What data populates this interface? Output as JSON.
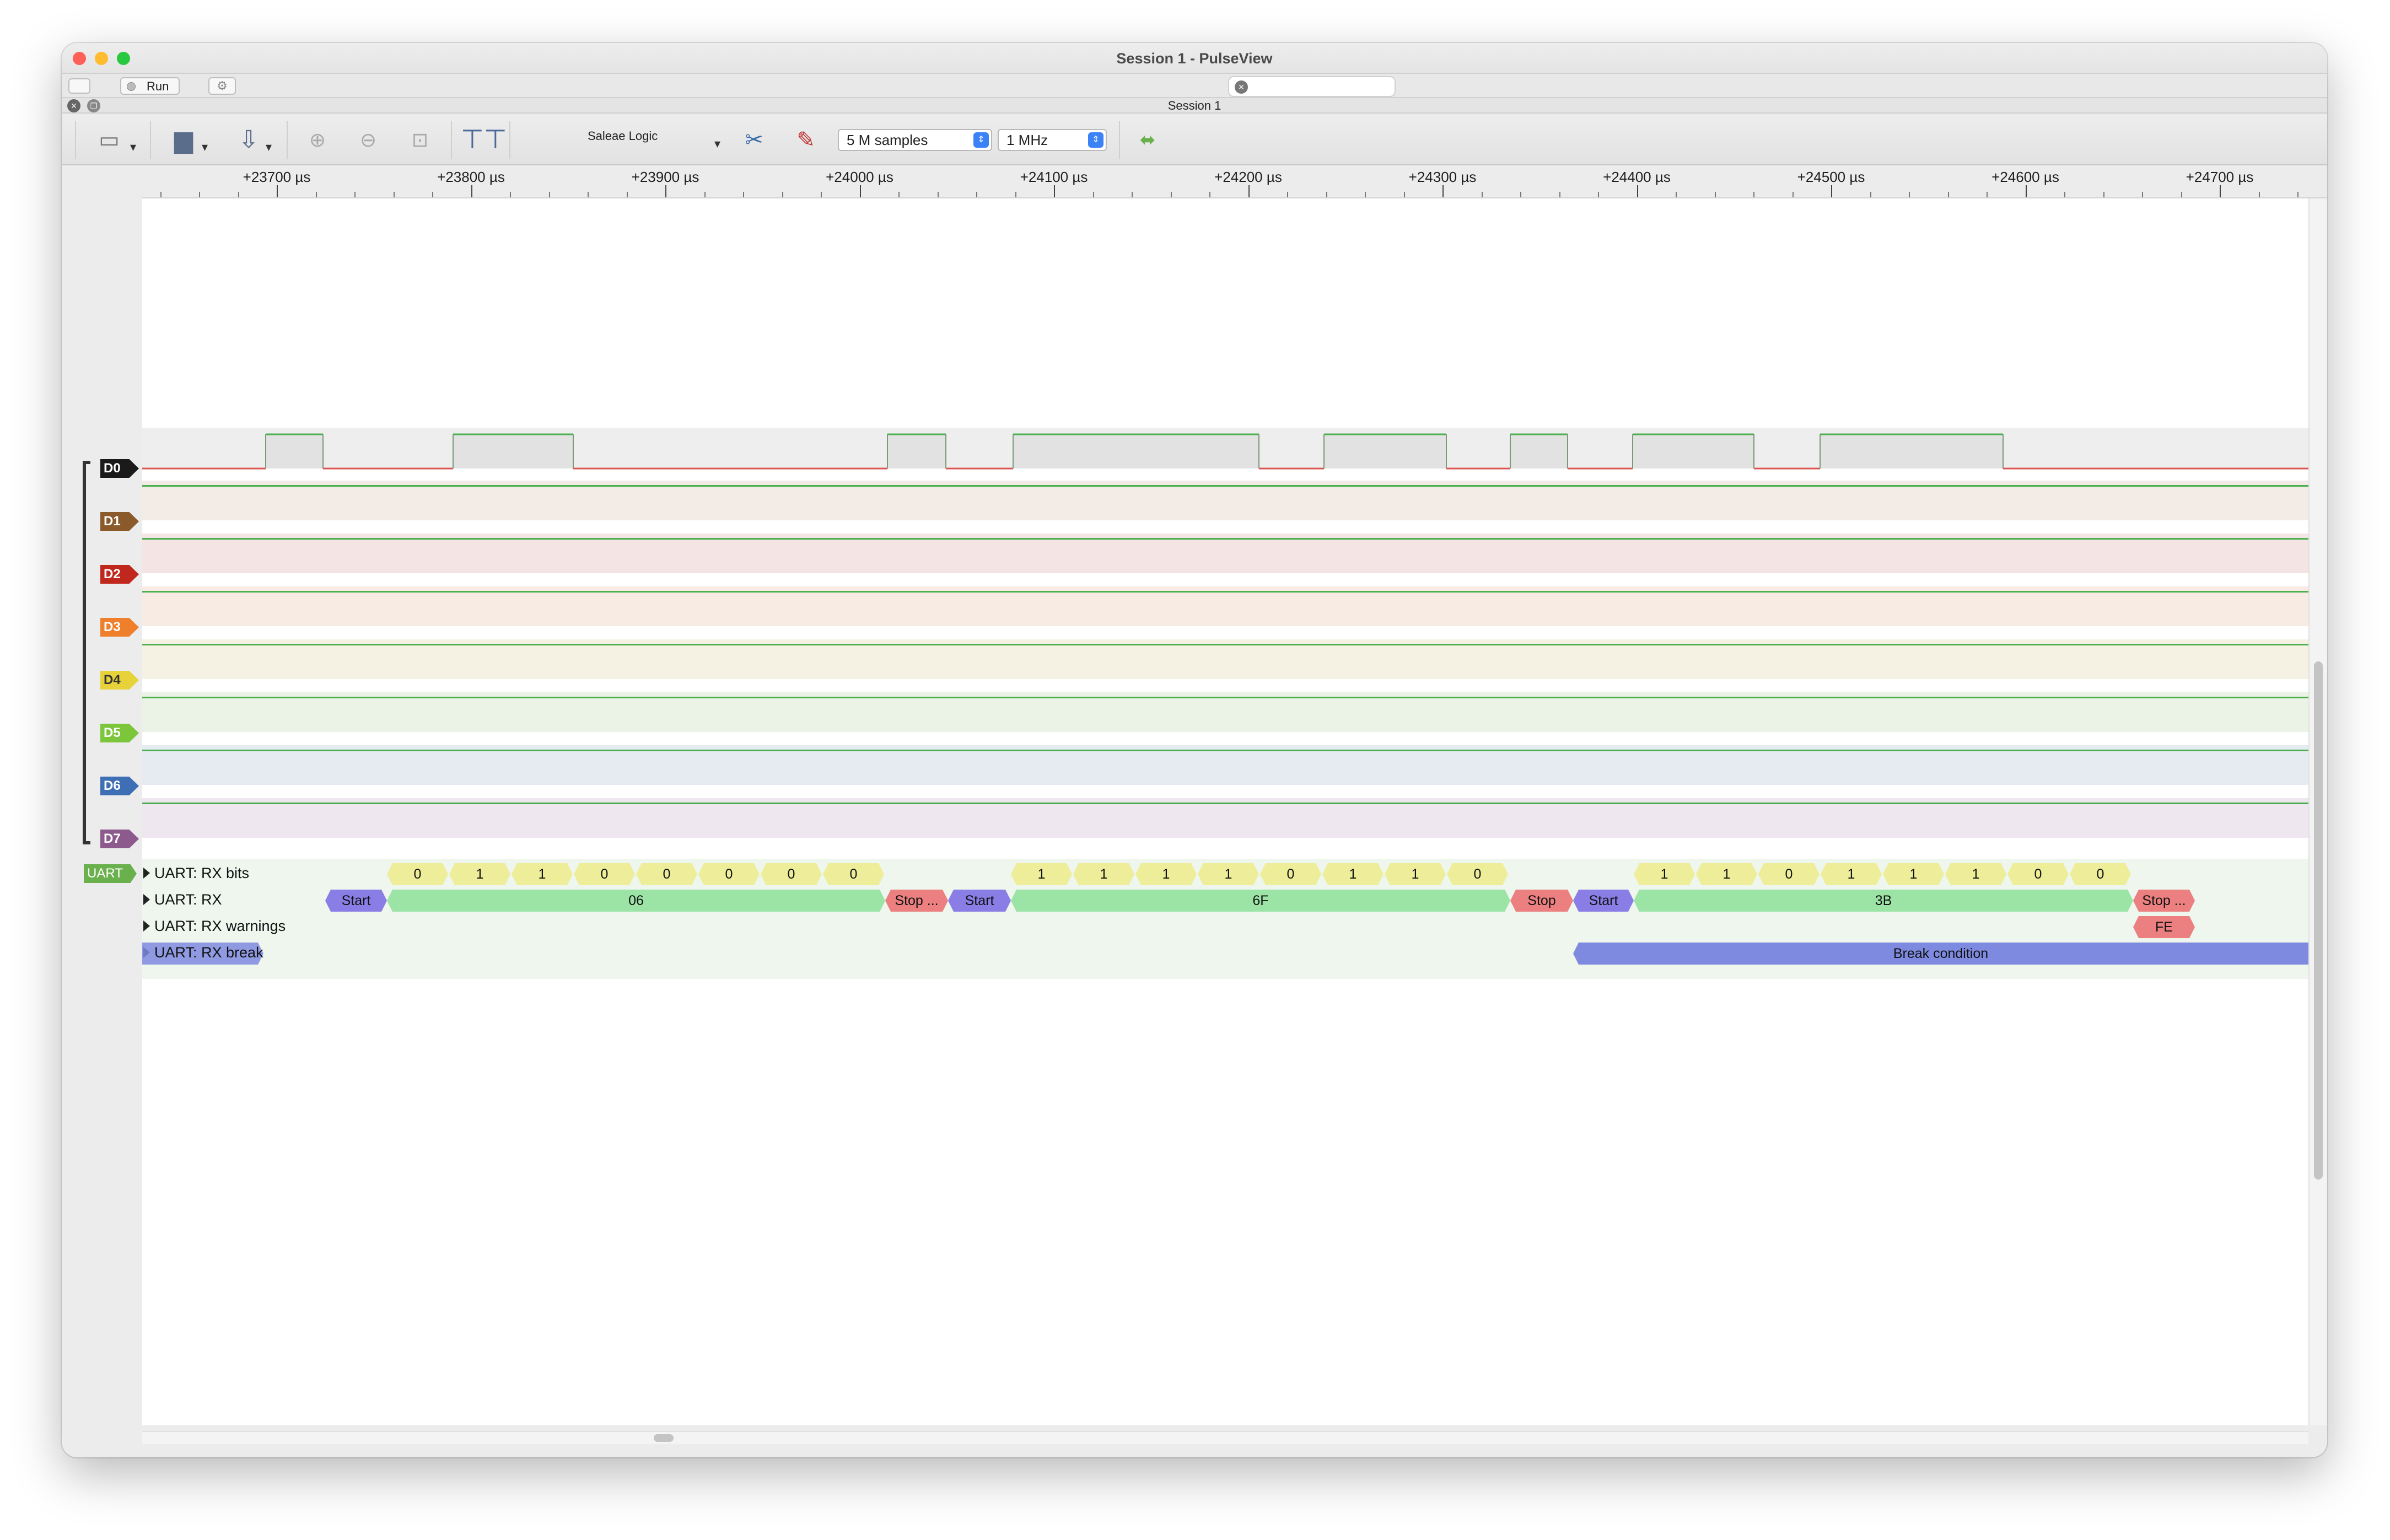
{
  "window": {
    "title": "Session 1 - PulseView"
  },
  "toolbar_top": {
    "run_label": "Run"
  },
  "session_tab": {
    "label": "Session 1"
  },
  "toolbar": {
    "device": "Saleae Logic",
    "samples": "5 M samples",
    "samplerate": "1 MHz"
  },
  "ruler": {
    "labels": [
      "+23700 µs",
      "+23800 µs",
      "+23900 µs",
      "+24000 µs",
      "+24100 µs",
      "+24200 µs",
      "+24300 µs",
      "+24400 µs",
      "+24500 µs",
      "+24600 µs",
      "+24700 µs"
    ]
  },
  "channels": [
    {
      "name": "D0",
      "color": "#1a1a1a"
    },
    {
      "name": "D1",
      "color": "#8b5a2b"
    },
    {
      "name": "D2",
      "color": "#c0281e"
    },
    {
      "name": "D3",
      "color": "#ef7f2b"
    },
    {
      "name": "D4",
      "color": "#e8d23a"
    },
    {
      "name": "D5",
      "color": "#7cc63c"
    },
    {
      "name": "D6",
      "color": "#3e6eb4"
    },
    {
      "name": "D7",
      "color": "#8c5a8c"
    }
  ],
  "decoder": {
    "tag": "UART",
    "rows": [
      "UART: RX bits",
      "UART: RX",
      "UART: RX warnings",
      "UART: RX break"
    ],
    "bits": [
      "0",
      "1",
      "1",
      "0",
      "0",
      "0",
      "0",
      "0",
      "1",
      "1",
      "1",
      "1",
      "0",
      "1",
      "1",
      "0",
      "1",
      "1",
      "0",
      "1",
      "1",
      "1",
      "0",
      "0"
    ],
    "frames": [
      {
        "start": "Start",
        "data": "06",
        "stop": "Stop ..."
      },
      {
        "start": "Start",
        "data": "6F",
        "stop": "Stop"
      },
      {
        "start": "Start",
        "data": "3B",
        "stop": "Stop ..."
      }
    ],
    "warning": "FE",
    "break_label": "Break condition"
  },
  "colors": {
    "bits": "#eeee9a",
    "data": "#9ce4a6",
    "start": "#8a7ee6",
    "stop": "#ec8080",
    "break": "#7e8ae0",
    "signal_high": "#4caf50",
    "signal_low": "#d9534f"
  }
}
